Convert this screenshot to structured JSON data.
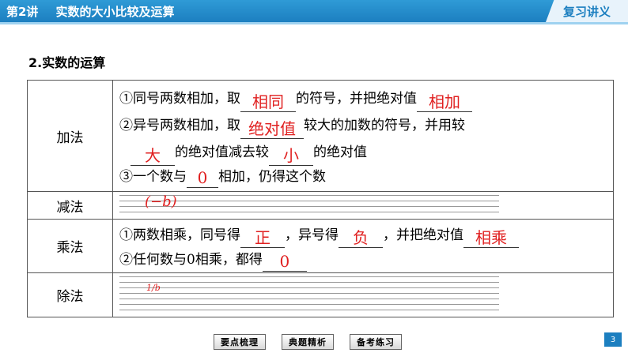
{
  "header": {
    "lecture_no": "第2讲",
    "lecture_title": "实数的大小比较及运算",
    "tag": "复习讲义"
  },
  "section_title": "2.实数的运算",
  "table": {
    "addition": {
      "label": "加法",
      "l1_a": "①同号两数相加，取",
      "l1_b1": "相同",
      "l1_c": "的符号，并把绝对值",
      "l1_b2": "相加",
      "l2_a": "②异号两数相加，取",
      "l2_b1": "绝对值",
      "l2_c": "较大的加数的符号，并用较",
      "l3_b1": "大",
      "l3_c": "的绝对值减去较",
      "l3_b2": "小",
      "l3_d": "的绝对值",
      "l4_a": "③一个数与",
      "l4_b1": "0",
      "l4_c": "相加，仍得这个数"
    },
    "subtraction": {
      "label": "减法",
      "red_note": "(−b)"
    },
    "multiplication": {
      "label": "乘法",
      "l1_a": "①两数相乘，同号得",
      "l1_b1": "正",
      "l1_c": "，异号得",
      "l1_b2": "负",
      "l1_d": "，并把绝对值",
      "l1_b3": "相乘",
      "l2_a": "②任何数与0相乘，都得",
      "l2_b1": "0"
    },
    "division": {
      "label": "除法",
      "red_note": "1/b"
    }
  },
  "footer": {
    "btn1": "要点梳理",
    "btn2": "典题精析",
    "btn3": "备考练习",
    "page": "3"
  }
}
